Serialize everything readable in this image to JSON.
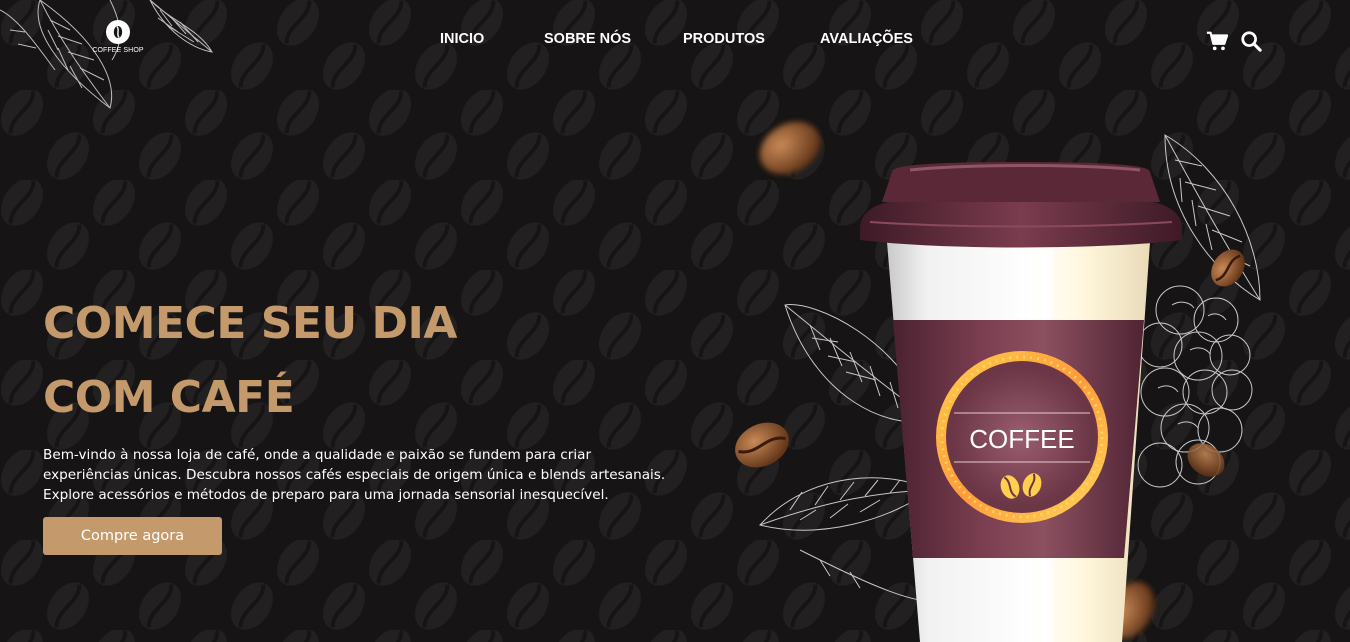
{
  "brand": {
    "logo_text": "COFFEE SHOP"
  },
  "nav": {
    "items": [
      {
        "label": "INICIO"
      },
      {
        "label": "SOBRE NÓS"
      },
      {
        "label": "PRODUTOS"
      },
      {
        "label": "AVALIAÇÕES"
      }
    ]
  },
  "header_icons": [
    "cart-icon",
    "search-icon"
  ],
  "hero": {
    "title_line1": "COMECE SEU DIA",
    "title_line2": "COM CAFÉ",
    "description_line1": "Bem-vindo à nossa loja de café, onde a qualidade e paixão se fundem para criar",
    "description_line2": "experiências únicas. Descubra nossos cafés especiais de origem única e blends artesanais.",
    "description_line3": "Explore acessórios e métodos de preparo para uma jornada sensorial inesquecível.",
    "cta_label": "Compre agora"
  },
  "cup": {
    "label": "COFFEE"
  },
  "colors": {
    "background": "#161414",
    "accent": "#c4996b",
    "cup_sleeve": "#6b3646",
    "cup_lid": "#5a2836"
  }
}
